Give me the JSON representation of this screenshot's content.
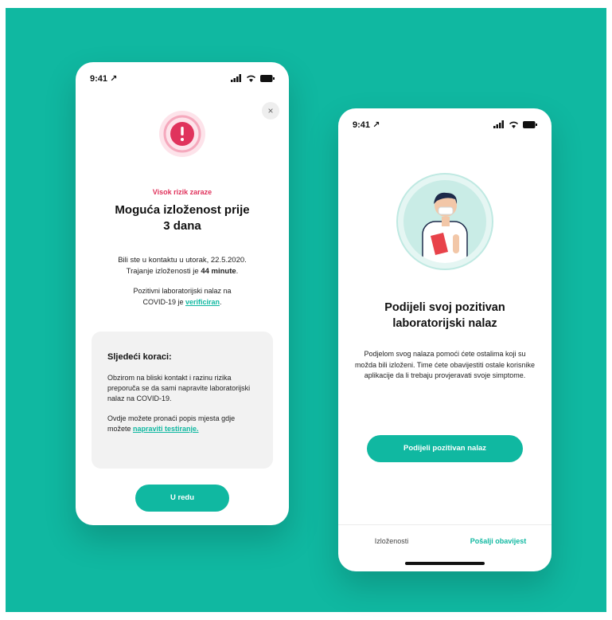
{
  "left_screen": {
    "status_time": "9:41",
    "close_icon": "×",
    "risk_label": "Visok rizik zaraze",
    "headline_line1": "Moguća izloženost prije",
    "headline_line2": "3 dana",
    "contact_line1": "Bili ste u kontaktu u utorak, 22.5.2020.",
    "contact_line2_prefix": "Trajanje izloženosti je ",
    "contact_duration": "44 minute",
    "contact_line2_suffix": ".",
    "lab_line1": "Pozitivni laboratorijski nalaz na",
    "lab_line2_prefix": "COVID-19 je ",
    "lab_link": "verificiran",
    "lab_line2_suffix": ".",
    "steps_title": "Sljedeći koraci:",
    "steps_text1": "Obzirom na bliski kontakt i razinu rizika preporuča se da sami napravite laboratorijski nalaz na COVID-19.",
    "steps_text2_prefix": "Ovdje možete pronaći popis mjesta gdje možete ",
    "steps_link": "napraviti testiranje.",
    "ok_button": "U redu"
  },
  "right_screen": {
    "status_time": "9:41",
    "headline_line1": "Podijeli svoj pozitivan",
    "headline_line2": "laboratorijski nalaz",
    "description": "Podjelom svog nalaza pomoći ćete ostalima koji su možda bili izloženi. Time ćete obavijestiti ostale korisnike aplikacije da li trebaju provjeravati svoje simptome.",
    "share_button": "Podijeli pozitivan nalaz",
    "tabs": [
      {
        "label": "Izloženosti",
        "active": false
      },
      {
        "label": "Pošalji obavijest",
        "active": true
      }
    ]
  },
  "colors": {
    "background": "#10b8a1",
    "accent": "#10b8a1",
    "risk": "#e0335c"
  },
  "icons": [
    "location-arrow-icon",
    "signal-icon",
    "wifi-icon",
    "battery-icon",
    "close-icon",
    "alert-icon",
    "doctor-illustration"
  ]
}
